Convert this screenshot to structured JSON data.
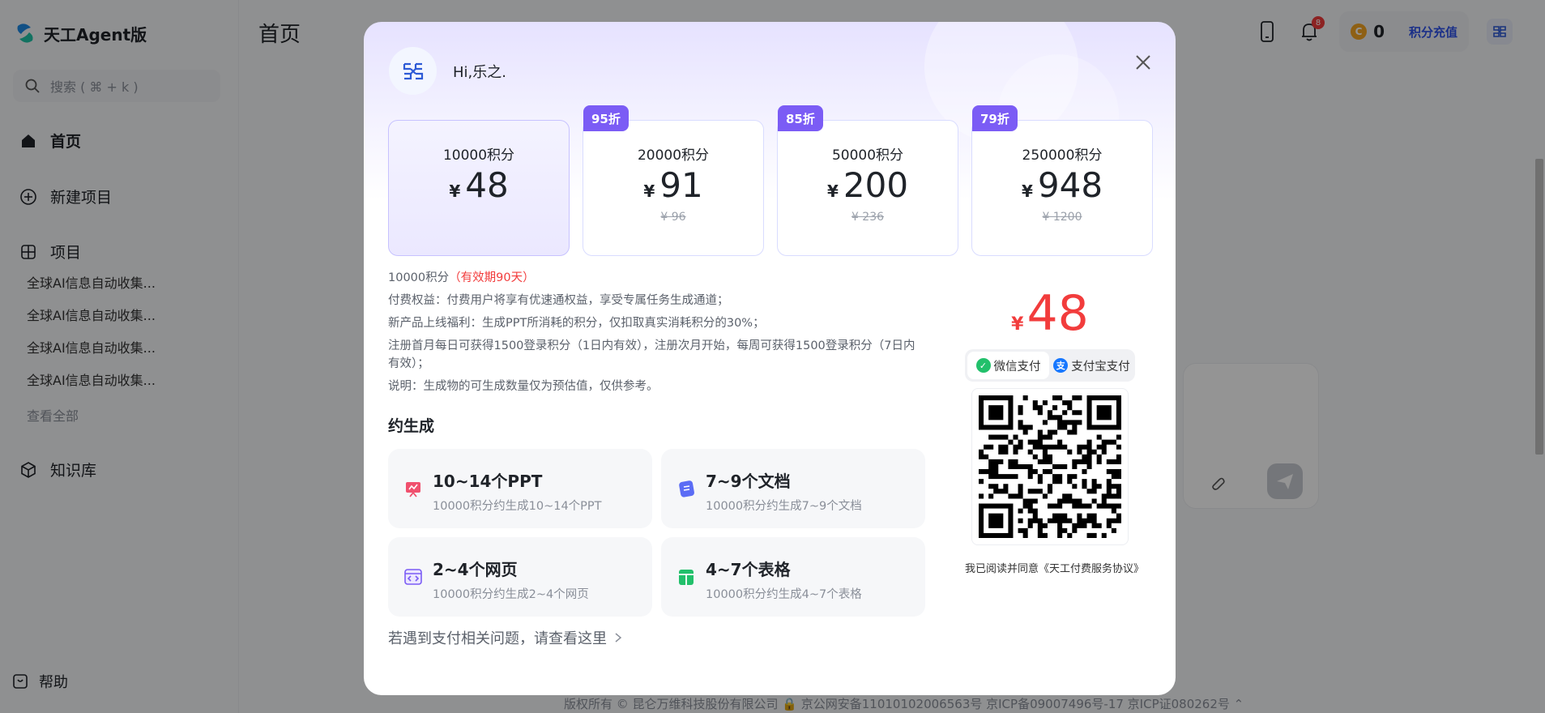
{
  "app": {
    "logo_text": "天工Agent版",
    "search_placeholder": "搜索 ( ⌘ + k )",
    "nav": {
      "home": "首页",
      "new_project": "新建项目",
      "projects": "项目",
      "knowledge": "知识库",
      "help": "帮助"
    },
    "projects": [
      "全球AI信息自动收集...",
      "全球AI信息自动收集...",
      "全球AI信息自动收集...",
      "全球AI信息自动收集..."
    ],
    "see_all": "查看全部",
    "page_title": "首页",
    "notification_count": "8",
    "points": "0",
    "recharge_label": "积分充值",
    "footer": "版权所有 © 昆仑万维科技股份有限公司 🔒 京公网安备11010102006563号 京ICP备09007496号-17 京ICP证080262号 ⌃"
  },
  "modal": {
    "greeting": "Hi,乐之.",
    "plans": [
      {
        "name": "10000积分",
        "currency": "¥",
        "price": "48",
        "original": "",
        "tag": "",
        "selected": true
      },
      {
        "name": "20000积分",
        "currency": "¥",
        "price": "91",
        "original": "¥ 96",
        "tag": "95折",
        "selected": false
      },
      {
        "name": "50000积分",
        "currency": "¥",
        "price": "200",
        "original": "¥ 236",
        "tag": "85折",
        "selected": false
      },
      {
        "name": "250000积分",
        "currency": "¥",
        "price": "948",
        "original": "¥ 1200",
        "tag": "79折",
        "selected": false
      }
    ],
    "info": {
      "points_line": "10000积分",
      "validity": "（有效期90天）",
      "benefit": "付费权益：付费用户将享有优速通权益，享受专属任务生成通道；",
      "new_product": "新产品上线福利：生成PPT所消耗的积分，仅扣取真实消耗积分的30%；",
      "register": "注册首月每日可获得1500登录积分（1日内有效），注册次月开始，每周可获得1500登录积分（7日内有效）；",
      "note": "说明：生成物的可生成数量仅为预估值，仅供参考。"
    },
    "gen_title": "约生成",
    "gen_items": [
      {
        "main": "10~14个PPT",
        "sub": "10000积分约生成10~14个PPT",
        "icon": "ppt-icon",
        "color": "#f0506e"
      },
      {
        "main": "7~9个文档",
        "sub": "10000积分约生成7~9个文档",
        "icon": "document-icon",
        "color": "#5b6cf5"
      },
      {
        "main": "2~4个网页",
        "sub": "10000积分约生成2~4个网页",
        "icon": "webpage-icon",
        "color": "#7b5cf5"
      },
      {
        "main": "4~7个表格",
        "sub": "10000积分约生成4~7个表格",
        "icon": "spreadsheet-icon",
        "color": "#22c06b"
      }
    ],
    "faq": "若遇到支付相关问题，请查看这里",
    "pay": {
      "currency": "¥",
      "amount": "48",
      "methods": [
        {
          "label": "微信支付",
          "active": true,
          "color": "#22c06b"
        },
        {
          "label": "支付宝支付",
          "active": false,
          "color": "#1677ff"
        }
      ],
      "agreement": "我已阅读并同意《天工付费服务协议》"
    }
  }
}
